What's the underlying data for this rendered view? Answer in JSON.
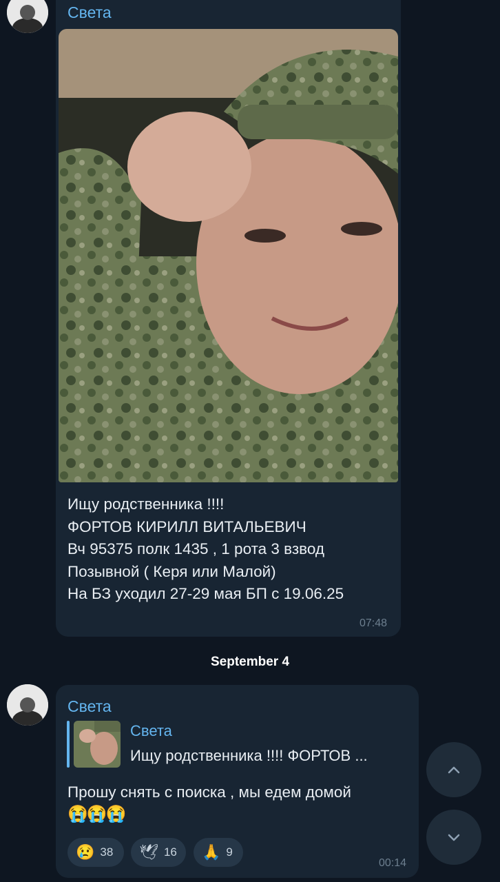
{
  "messages": [
    {
      "sender": "Света",
      "text_lines": [
        "Ищу родственника !!!!",
        "ФОРТОВ КИРИЛЛ ВИТАЛЬЕВИЧ",
        "Вч 95375 полк 1435 , 1 рота 3 взвод",
        "Позывной ( Керя или Малой)",
        "На БЗ уходил 27-29 мая БП с 19.06.25"
      ],
      "time": "07:48"
    },
    {
      "sender": "Света",
      "reply": {
        "name": "Света",
        "text": "Ищу родственника !!!! ФОРТОВ ..."
      },
      "text": "Прошу снять с поиска , мы едем домой",
      "emojis": "😭😭😭",
      "reactions": [
        {
          "emoji": "😢",
          "count": "38"
        },
        {
          "emoji": "🕊",
          "count": "16"
        },
        {
          "emoji": "🙏",
          "count": "9"
        }
      ],
      "time": "00:14"
    }
  ],
  "date_separator": "September 4",
  "nav": {
    "up_icon": "chevron-up-icon",
    "down_icon": "chevron-down-icon"
  },
  "colors": {
    "background": "#0e1621",
    "bubble": "#182533",
    "accent": "#64b5ef"
  }
}
